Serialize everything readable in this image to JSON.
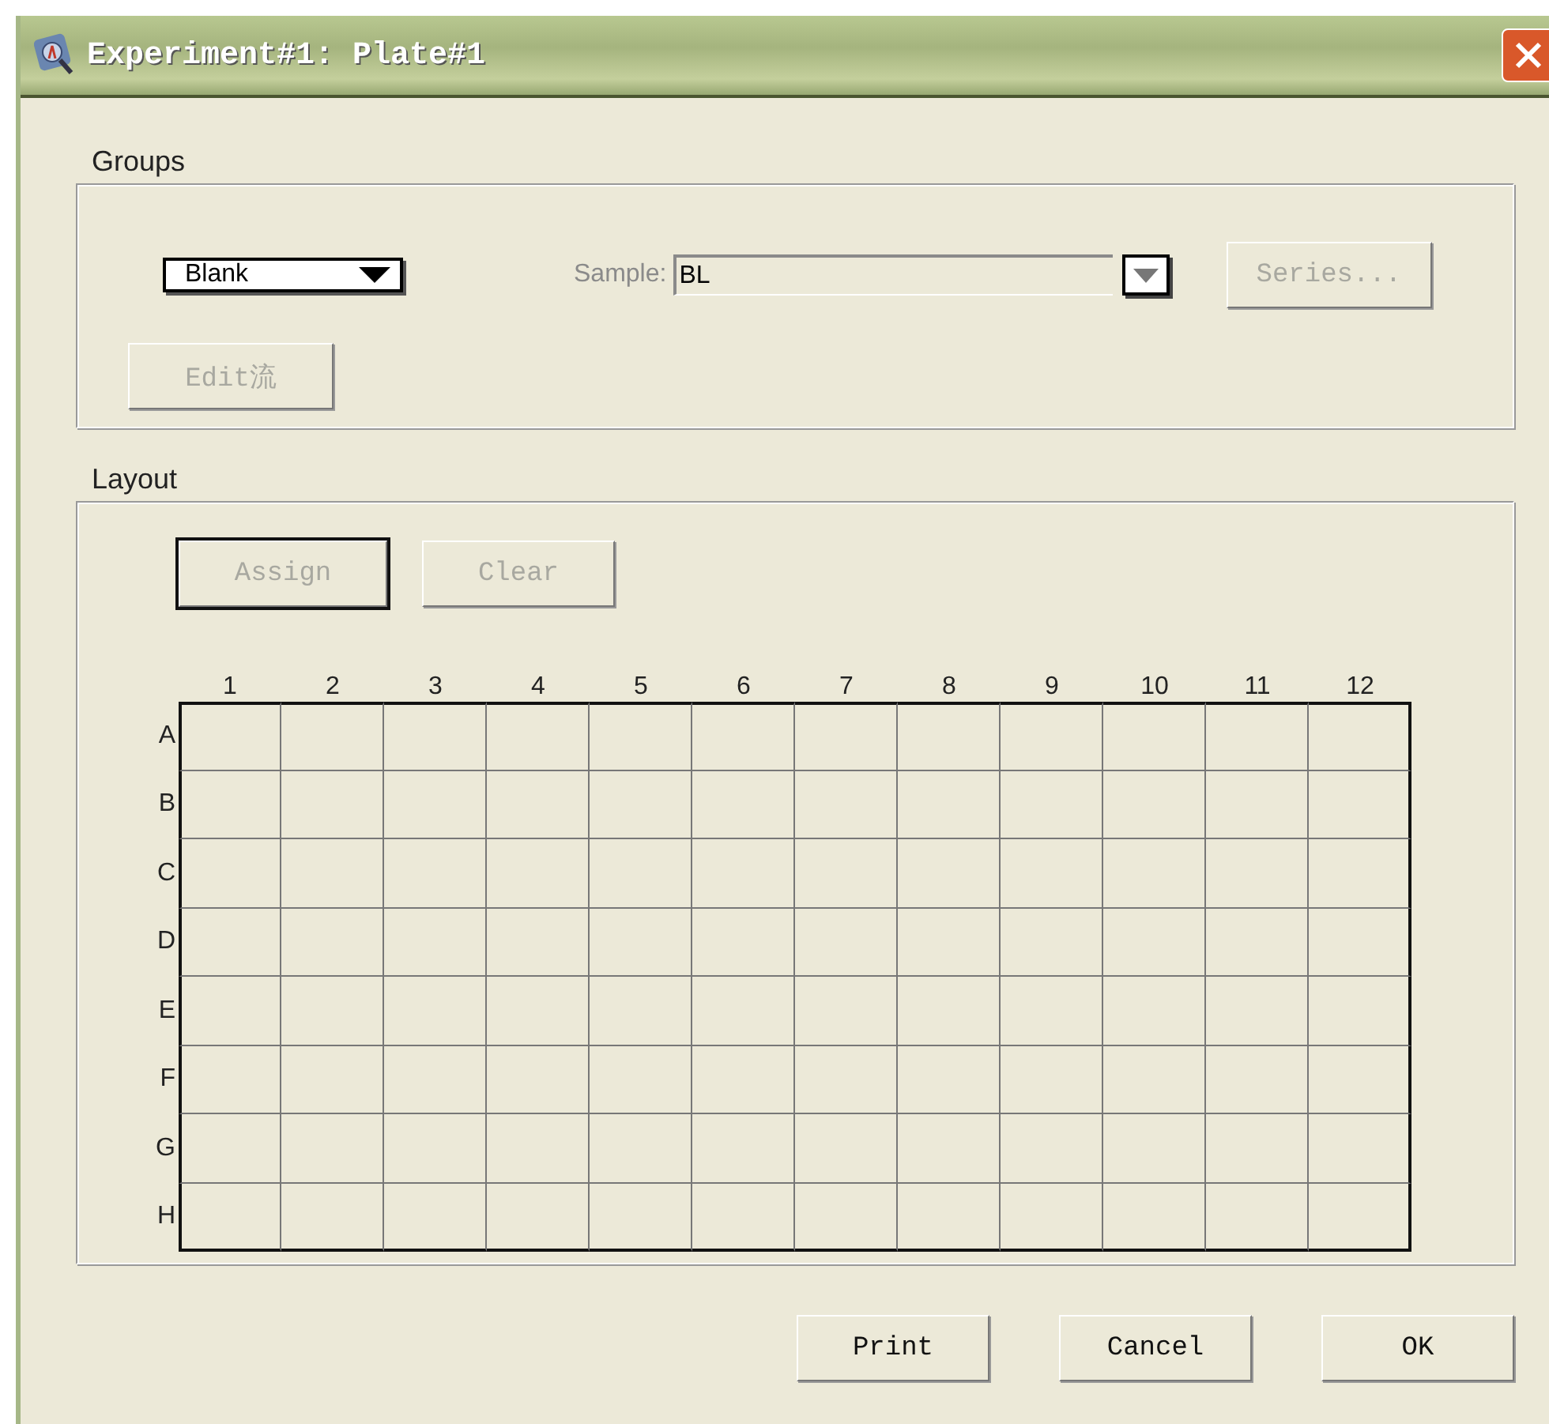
{
  "window": {
    "title": "Experiment#1: Plate#1"
  },
  "groups": {
    "label": "Groups",
    "group_select": {
      "value": "Blank"
    },
    "sample": {
      "label": "Sample:",
      "value": "BL",
      "disabled": true
    },
    "buttons": [
      {
        "label": "Series...",
        "disabled": true,
        "default": false
      },
      {
        "label": "Edit流",
        "disabled": true,
        "default": false
      }
    ]
  },
  "layout": {
    "label": "Layout",
    "buttons": [
      {
        "label": "Assign",
        "disabled": true,
        "default": true
      },
      {
        "label": "Clear",
        "disabled": true,
        "default": false
      }
    ],
    "columns": [
      "1",
      "2",
      "3",
      "4",
      "5",
      "6",
      "7",
      "8",
      "9",
      "10",
      "11",
      "12"
    ],
    "rows": [
      "A",
      "B",
      "C",
      "D",
      "E",
      "F",
      "G",
      "H"
    ]
  },
  "buttons": [
    {
      "label": "Print",
      "disabled": false,
      "default": false
    },
    {
      "label": "Cancel",
      "disabled": false,
      "default": false
    },
    {
      "label": "OK",
      "disabled": false,
      "default": false
    }
  ]
}
